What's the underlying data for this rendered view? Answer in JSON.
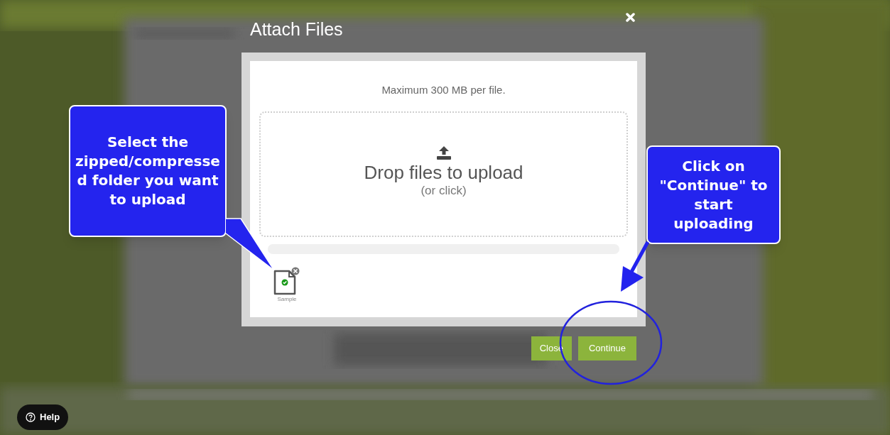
{
  "modal": {
    "title": "Attach Files",
    "note": "Maximum 300 MB per file.",
    "dropzone": {
      "title": "Drop files to upload",
      "hint": "(or click)"
    },
    "files": [
      {
        "name": "Sample",
        "uploaded": true
      }
    ],
    "buttons": [
      {
        "label": "Close",
        "kind": "secondary"
      },
      {
        "label": "Continue",
        "kind": "primary"
      }
    ]
  },
  "callouts": [
    {
      "text": "Select the zipped/compressed folder you want to upload",
      "kind": "left"
    },
    {
      "text": "Click on \"Continue\" to start uploading",
      "kind": "right"
    }
  ],
  "help": {
    "label": "Help"
  }
}
